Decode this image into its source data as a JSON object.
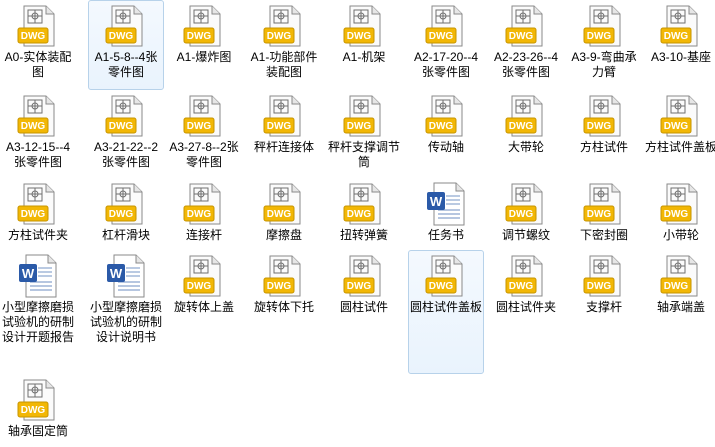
{
  "files": [
    {
      "name": "A0-实体装配图",
      "type": "dwg",
      "badge": "DWG"
    },
    {
      "name": "A1-5-8--4张零件图",
      "type": "dwg",
      "badge": "DWG",
      "selected": true
    },
    {
      "name": "A1-爆炸图",
      "type": "dwg",
      "badge": "DWG"
    },
    {
      "name": "A1-功能部件装配图",
      "type": "dwg",
      "badge": "DWG"
    },
    {
      "name": "A1-机架",
      "type": "dwg",
      "badge": "DWG"
    },
    {
      "name": "A2-17-20--4张零件图",
      "type": "dwg",
      "badge": "DWG"
    },
    {
      "name": "A2-23-26--4张零件图",
      "type": "dwg",
      "badge": "DWG"
    },
    {
      "name": "A3-9-弯曲承力臂",
      "type": "dwg",
      "badge": "DWG"
    },
    {
      "name": "A3-10-基座",
      "type": "dwg",
      "badge": "DWG"
    },
    {
      "name": "A3-12-15--4张零件图",
      "type": "dwg",
      "badge": "DWG"
    },
    {
      "name": "A3-21-22--2张零件图",
      "type": "dwg",
      "badge": "DWG"
    },
    {
      "name": "A3-27-8--2张零件图",
      "type": "dwg",
      "badge": "DWG"
    },
    {
      "name": "秤杆连接体",
      "type": "dwg",
      "badge": "DWG"
    },
    {
      "name": "秤杆支撑调节筒",
      "type": "dwg",
      "badge": "DWG"
    },
    {
      "name": "传动轴",
      "type": "dwg",
      "badge": "DWG"
    },
    {
      "name": "大带轮",
      "type": "dwg",
      "badge": "DWG"
    },
    {
      "name": "方柱试件",
      "type": "dwg",
      "badge": "DWG"
    },
    {
      "name": "方柱试件盖板",
      "type": "dwg",
      "badge": "DWG"
    },
    {
      "name": "方柱试件夹",
      "type": "dwg",
      "badge": "DWG"
    },
    {
      "name": "杠杆滑块",
      "type": "dwg",
      "badge": "DWG"
    },
    {
      "name": "连接杆",
      "type": "dwg",
      "badge": "DWG"
    },
    {
      "name": "摩擦盘",
      "type": "dwg",
      "badge": "DWG"
    },
    {
      "name": "扭转弹簧",
      "type": "dwg",
      "badge": "DWG"
    },
    {
      "name": "任务书",
      "type": "doc"
    },
    {
      "name": "调节螺纹",
      "type": "dwg",
      "badge": "DWG"
    },
    {
      "name": "下密封圈",
      "type": "dwg",
      "badge": "DWG"
    },
    {
      "name": "小带轮",
      "type": "dwg",
      "badge": "DWG"
    },
    {
      "name": "小型摩擦磨损试验机的研制设计开题报告",
      "type": "doc"
    },
    {
      "name": "小型摩擦磨损试验机的研制设计说明书",
      "type": "doc"
    },
    {
      "name": "旋转体上盖",
      "type": "dwg",
      "badge": "DWG"
    },
    {
      "name": "旋转体下托",
      "type": "dwg",
      "badge": "DWG"
    },
    {
      "name": "圆柱试件",
      "type": "dwg",
      "badge": "DWG"
    },
    {
      "name": "圆柱试件盖板",
      "type": "dwg",
      "badge": "DWG",
      "selected": true
    },
    {
      "name": "圆柱试件夹",
      "type": "dwg",
      "badge": "DWG"
    },
    {
      "name": "支撑杆",
      "type": "dwg",
      "badge": "DWG"
    },
    {
      "name": "轴承端盖",
      "type": "dwg",
      "badge": "DWG"
    },
    {
      "name": "轴承固定筒",
      "type": "dwg",
      "badge": "DWG"
    }
  ],
  "colors": {
    "dwg_badge": "#f2b705",
    "dwg_badge_text": "#ffffff",
    "doc_blue": "#2b5aa8",
    "selection_border": "#b7d2ea"
  }
}
